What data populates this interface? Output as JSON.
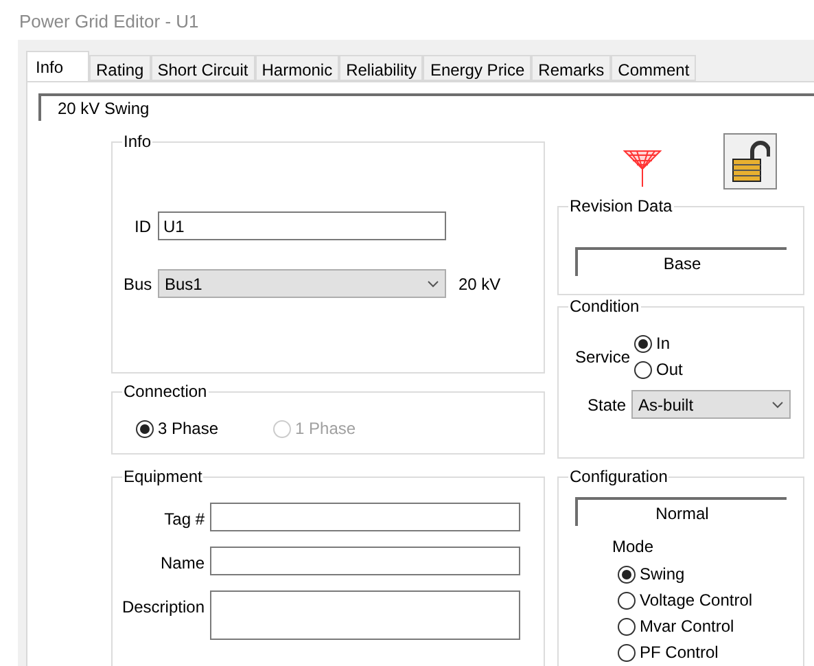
{
  "window": {
    "title": "Power Grid Editor - U1"
  },
  "tabs": [
    {
      "label": "Info",
      "selected": true
    },
    {
      "label": "Rating",
      "selected": false
    },
    {
      "label": "Short Circuit",
      "selected": false
    },
    {
      "label": "Harmonic",
      "selected": false
    },
    {
      "label": "Reliability",
      "selected": false
    },
    {
      "label": "Energy Price",
      "selected": false
    },
    {
      "label": "Remarks",
      "selected": false
    },
    {
      "label": "Comment",
      "selected": false
    }
  ],
  "header": "20 kV  Swing",
  "info": {
    "title": "Info",
    "id_label": "ID",
    "id_value": "U1",
    "bus_label": "Bus",
    "bus_value": "Bus1",
    "bus_kv": "20 kV"
  },
  "connection": {
    "title": "Connection",
    "options": [
      {
        "label": "3 Phase",
        "selected": true,
        "disabled": false
      },
      {
        "label": "1 Phase",
        "selected": false,
        "disabled": true
      }
    ]
  },
  "equipment": {
    "title": "Equipment",
    "fields": [
      {
        "label": "Tag #",
        "kind": "line"
      },
      {
        "label": "Name",
        "kind": "line"
      },
      {
        "label": "Description",
        "kind": "area"
      }
    ]
  },
  "lock": {
    "locked": false
  },
  "revision": {
    "title": "Revision Data",
    "value": "Base"
  },
  "condition": {
    "title": "Condition",
    "service_label": "Service",
    "service": [
      {
        "label": "In",
        "selected": true
      },
      {
        "label": "Out",
        "selected": false
      }
    ],
    "state_label": "State",
    "state_value": "As-built"
  },
  "configuration": {
    "title": "Configuration",
    "value": "Normal",
    "mode_label": "Mode",
    "modes": [
      {
        "label": "Swing",
        "selected": true
      },
      {
        "label": "Voltage Control",
        "selected": false
      },
      {
        "label": "Mvar Control",
        "selected": false
      },
      {
        "label": "PF Control",
        "selected": false
      }
    ]
  }
}
